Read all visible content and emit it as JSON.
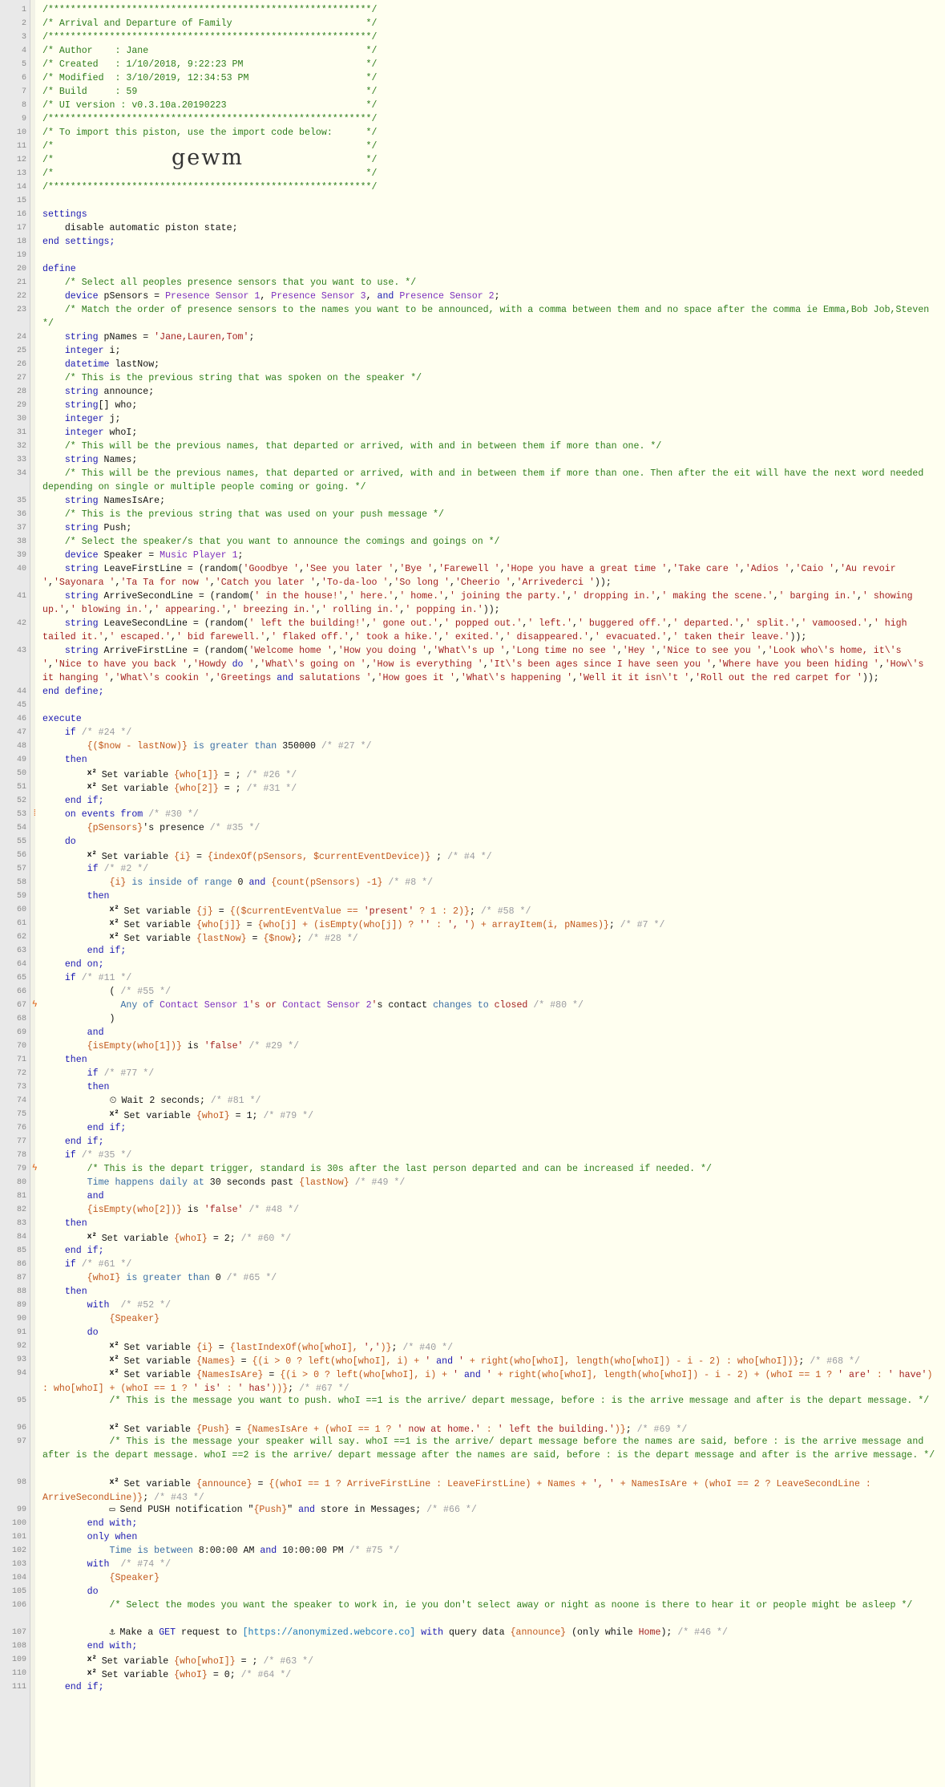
{
  "document": {
    "title": "Arrival and Departure of Family",
    "author": "Jane",
    "import_code": "gewm",
    "lines": [
      {
        "n": "1",
        "t": "/**********************************************************/",
        "cls": "c"
      },
      {
        "n": "2",
        "t": "/* Arrival and Departure of Family                        */",
        "cls": "c"
      },
      {
        "n": "3",
        "t": "/**********************************************************/",
        "cls": "c"
      },
      {
        "n": "4",
        "t": "/* Author    : Jane                                       */",
        "cls": "c"
      },
      {
        "n": "5",
        "t": "/* Created   : 1/10/2018, 9:22:23 PM                      */",
        "cls": "c"
      },
      {
        "n": "6",
        "t": "/* Modified  : 3/10/2019, 12:34:53 PM                     */",
        "cls": "c"
      },
      {
        "n": "7",
        "t": "/* Build     : 59                                         */",
        "cls": "c"
      },
      {
        "n": "8",
        "t": "/* UI version : v0.3.10a.20190223                         */",
        "cls": "c"
      },
      {
        "n": "9",
        "t": "/**********************************************************/",
        "cls": "c"
      },
      {
        "n": "10",
        "t": "/* To import this piston, use the import code below:      */",
        "cls": "c"
      },
      {
        "n": "11",
        "t": "/*                                                        */",
        "cls": "c"
      },
      {
        "n": "12",
        "t": "/*                                                        */",
        "cls": "c"
      },
      {
        "n": "13",
        "t": "/*                                                        */",
        "cls": "c"
      },
      {
        "n": "14",
        "t": "/**********************************************************/",
        "cls": "c"
      },
      {
        "n": "15",
        "t": ""
      },
      {
        "n": "16",
        "t": "settings",
        "cls": "k"
      },
      {
        "n": "17",
        "t": "    disable automatic piston state;"
      },
      {
        "n": "18",
        "t": "end settings;",
        "cls": "k"
      },
      {
        "n": "19",
        "t": ""
      },
      {
        "n": "20",
        "t": "define",
        "cls": "k"
      },
      {
        "n": "21",
        "t": "    /* Select all peoples presence sensors that you want to use. */",
        "cls": "c"
      },
      {
        "n": "22",
        "t": "    device pSensors = Presence Sensor 1, Presence Sensor 3, and Presence Sensor 2;"
      },
      {
        "n": "23",
        "t": "    /* Match the order of presence sensors to the names you want to be announced, with a comma between them and no space after the comma ie Emma,Bob Job,Steven */",
        "cls": "c"
      },
      {
        "n": "24",
        "t": "    string pNames = 'Jane,Lauren,Tom';"
      },
      {
        "n": "25",
        "t": "    integer i;"
      },
      {
        "n": "26",
        "t": "    datetime lastNow;"
      },
      {
        "n": "27",
        "t": "    /* This is the previous string that was spoken on the speaker */",
        "cls": "c"
      },
      {
        "n": "28",
        "t": "    string announce;"
      },
      {
        "n": "29",
        "t": "    string[] who;"
      },
      {
        "n": "30",
        "t": "    integer j;"
      },
      {
        "n": "31",
        "t": "    integer whoI;"
      },
      {
        "n": "32",
        "t": "    /* This will be the previous names, that departed or arrived, with and in between them if more than one. */",
        "cls": "c"
      },
      {
        "n": "33",
        "t": "    string Names;"
      },
      {
        "n": "34",
        "t": "    /* This will be the previous names, that departed or arrived, with and in between them if more than one. Then after the eit will have the next word needed depending on single or multiple people coming or going. */",
        "cls": "c"
      },
      {
        "n": "35",
        "t": "    string NamesIsAre;"
      },
      {
        "n": "36",
        "t": "    /* This is the previous string that was used on your push message */",
        "cls": "c"
      },
      {
        "n": "37",
        "t": "    string Push;"
      },
      {
        "n": "38",
        "t": "    /* Select the speaker/s that you want to announce the comings and goings on */",
        "cls": "c"
      },
      {
        "n": "39",
        "t": "    device Speaker = Music Player 1;"
      },
      {
        "n": "40",
        "t": "    string LeaveFirstLine = (random('Goodbye ','See you later ','Bye ','Farewell ','Hope you have a great time ','Take care ','Adios ','Caio ','Au revoir ','Sayonara ','Ta Ta for now ','Catch you later ','To-da-loo ','So long ','Cheerio ','Arrivederci '));"
      },
      {
        "n": "41",
        "t": "    string ArriveSecondLine = (random(' in the house!',' here.',' home.',' joining the party.',' dropping in.',' making the scene.',' barging in.',' showing up.',' blowing in.',' appearing.',' breezing in.',' rolling in.',' popping in.'));"
      },
      {
        "n": "42",
        "t": "    string LeaveSecondLine = (random(' left the building!',' gone out.',' popped out.',' left.',' buggered off.',' departed.',' split.',' vamoosed.',' high tailed it.',' escaped.',' bid farewell.',' flaked off.',' took a hike.',' exited.',' disappeared.',' evacuated.',' taken their leave.'));"
      },
      {
        "n": "43",
        "t": "    string ArriveFirstLine = (random('Welcome home ','How you doing ','What\\'s up ','Long time no see ','Hey ','Nice to see you ','Look who\\'s home, it\\'s ','Nice to have you back ','Howdy do ','What\\'s going on ','How is everything ','It\\'s been ages since I have seen you ','Where have you been hiding ','How\\'s it hanging ','What\\'s cookin ','Greetings and salutations ','How goes it ','What\\'s happening ','Well it it isn\\'t ','Roll out the red carpet for '));"
      },
      {
        "n": "44",
        "t": "end define;",
        "cls": "k"
      },
      {
        "n": "45",
        "t": ""
      },
      {
        "n": "46",
        "t": "execute",
        "cls": "k"
      },
      {
        "n": "47",
        "t": "    if /* #24 */"
      },
      {
        "n": "48",
        "t": "        {($now - lastNow)} is greater than 350000 /* #27 */"
      },
      {
        "n": "49",
        "t": "    then",
        "cls": "k"
      },
      {
        "n": "50",
        "t": "        Set variable {who[1]} = ; /* #26 */",
        "x2": true
      },
      {
        "n": "51",
        "t": "        Set variable {who[2]} = ; /* #31 */",
        "x2": true
      },
      {
        "n": "52",
        "t": "    end if;",
        "cls": "k"
      },
      {
        "n": "53",
        "t": "    on events from /* #30 */"
      },
      {
        "n": "54",
        "t": "        {pSensors}'s presence /* #35 */"
      },
      {
        "n": "55",
        "t": "    do",
        "cls": "k"
      },
      {
        "n": "56",
        "t": "        Set variable {i} = {indexOf(pSensors, $currentEventDevice)} ; /* #4 */",
        "x2": true
      },
      {
        "n": "57",
        "t": "        if /* #2 */"
      },
      {
        "n": "58",
        "t": "            {i} is inside of range 0 and {count(pSensors) -1} /* #8 */"
      },
      {
        "n": "59",
        "t": "        then",
        "cls": "k"
      },
      {
        "n": "60",
        "t": "            Set variable {j} = {($currentEventValue == 'present' ? 1 : 2)}; /* #58 */",
        "x2": true
      },
      {
        "n": "61",
        "t": "            Set variable {who[j]} = {who[j] + (isEmpty(who[j]) ? '' : ', ') + arrayItem(i, pNames)}; /* #7 */",
        "x2": true
      },
      {
        "n": "62",
        "t": "            Set variable {lastNow} = {$now}; /* #28 */",
        "x2": true
      },
      {
        "n": "63",
        "t": "        end if;",
        "cls": "k"
      },
      {
        "n": "64",
        "t": "    end on;",
        "cls": "k"
      },
      {
        "n": "65",
        "t": "    if /* #11 */"
      },
      {
        "n": "66",
        "t": "            ( /* #55 */"
      },
      {
        "n": "67",
        "t": "              Any of Contact Sensor 1's or Contact Sensor 2's contact changes to closed /* #80 */"
      },
      {
        "n": "68",
        "t": "            )"
      },
      {
        "n": "69",
        "t": "        and"
      },
      {
        "n": "70",
        "t": "        {isEmpty(who[1])} is 'false' /* #29 */"
      },
      {
        "n": "71",
        "t": "    then",
        "cls": "k"
      },
      {
        "n": "72",
        "t": "        if /* #77 */"
      },
      {
        "n": "73",
        "t": "        then",
        "cls": "k"
      },
      {
        "n": "74",
        "t": "            Wait 2 seconds; /* #81 */",
        "clock": true
      },
      {
        "n": "75",
        "t": "            Set variable {whoI} = 1; /* #79 */",
        "x2": true
      },
      {
        "n": "76",
        "t": "        end if;",
        "cls": "k"
      },
      {
        "n": "77",
        "t": "    end if;",
        "cls": "k"
      },
      {
        "n": "78",
        "t": "    if /* #35 */"
      },
      {
        "n": "79",
        "t": "        /* This is the depart trigger, standard is 30s after the last person departed and can be increased if needed. */",
        "cls": "c"
      },
      {
        "n": "80",
        "t": "        Time happens daily at 30 seconds past {lastNow} /* #49 */"
      },
      {
        "n": "81",
        "t": "        and"
      },
      {
        "n": "82",
        "t": "        {isEmpty(who[2])} is 'false' /* #48 */"
      },
      {
        "n": "83",
        "t": "    then",
        "cls": "k"
      },
      {
        "n": "84",
        "t": "        Set variable {whoI} = 2; /* #60 */",
        "x2": true
      },
      {
        "n": "85",
        "t": "    end if;",
        "cls": "k"
      },
      {
        "n": "86",
        "t": "    if /* #61 */"
      },
      {
        "n": "87",
        "t": "        {whoI} is greater than 0 /* #65 */"
      },
      {
        "n": "88",
        "t": "    then",
        "cls": "k"
      },
      {
        "n": "89",
        "t": "        with  /* #52 */",
        "badge": true
      },
      {
        "n": "90",
        "t": "            {Speaker}"
      },
      {
        "n": "91",
        "t": "        do",
        "cls": "k"
      },
      {
        "n": "92",
        "t": "            Set variable {i} = {lastIndexOf(who[whoI], ',')}; /* #40 */",
        "x2": true
      },
      {
        "n": "93",
        "t": "            Set variable {Names} = {(i > 0 ? left(who[whoI], i) + ' and ' + right(who[whoI], length(who[whoI]) - i - 2) : who[whoI])}; /* #68 */",
        "x2": true
      },
      {
        "n": "94",
        "t": "            Set variable {NamesIsAre} = {(i > 0 ? left(who[whoI], i) + ' and ' + right(who[whoI], length(who[whoI]) - i - 2) + (whoI == 1 ? ' are' : ' have') : who[whoI] + (whoI == 1 ? ' is' : ' has'))}; /* #67 */",
        "x2": true
      },
      {
        "n": "95",
        "t": "            /* This is the message you want to push. whoI ==1 is the arrive/ depart message, before : is the arrive message and after is the depart message. */",
        "cls": "c"
      },
      {
        "n": "96",
        "t": "            Set variable {Push} = {NamesIsAre + (whoI == 1 ? ' now at home.' : ' left the building.')}; /* #69 */",
        "x2": true
      },
      {
        "n": "97",
        "t": "            /* This is the message your speaker will say. whoI ==1 is the arrive/ depart message before the names are said, before : is the arrive message and after is the depart message. whoI ==2 is the arrive/ depart message after the names are said, before : is the depart message and after is the arrive message. */",
        "cls": "c"
      },
      {
        "n": "98",
        "t": "            Set variable {announce} = {(whoI == 1 ? ArriveFirstLine : LeaveFirstLine) + Names + ', ' + NamesIsAre + (whoI == 2 ? LeaveSecondLine : ArriveSecondLine)}; /* #43 */",
        "x2": true
      },
      {
        "n": "99",
        "t": "            Send PUSH notification \"{Push}\" and store in Messages; /* #66 */",
        "chat": true
      },
      {
        "n": "100",
        "t": "        end with;",
        "cls": "k"
      },
      {
        "n": "101",
        "t": "        only when",
        "cls": "k"
      },
      {
        "n": "102",
        "t": "            Time is between 8:00:00 AM and 10:00:00 PM /* #75 */"
      },
      {
        "n": "103",
        "t": "        with  /* #74 */",
        "badge": true
      },
      {
        "n": "104",
        "t": "            {Speaker}"
      },
      {
        "n": "105",
        "t": "        do",
        "cls": "k"
      },
      {
        "n": "106",
        "t": "            /* Select the modes you want the speaker to work in, ie you don't select away or night as noone is there to hear it or people might be asleep */",
        "cls": "c"
      },
      {
        "n": "107",
        "t": "            Make a GET request to [https://anonymized.webcore.co] with query data {announce} (only while Home); /* #46 */",
        "anchor": true
      },
      {
        "n": "108",
        "t": "        end with;",
        "cls": "k"
      },
      {
        "n": "109",
        "t": "        Set variable {who[whoI]} = ; /* #63 */",
        "x2": true
      },
      {
        "n": "110",
        "t": "        Set variable {whoI} = 0; /* #64 */",
        "x2": true
      },
      {
        "n": "111",
        "t": "    end if;",
        "cls": "k"
      }
    ]
  }
}
